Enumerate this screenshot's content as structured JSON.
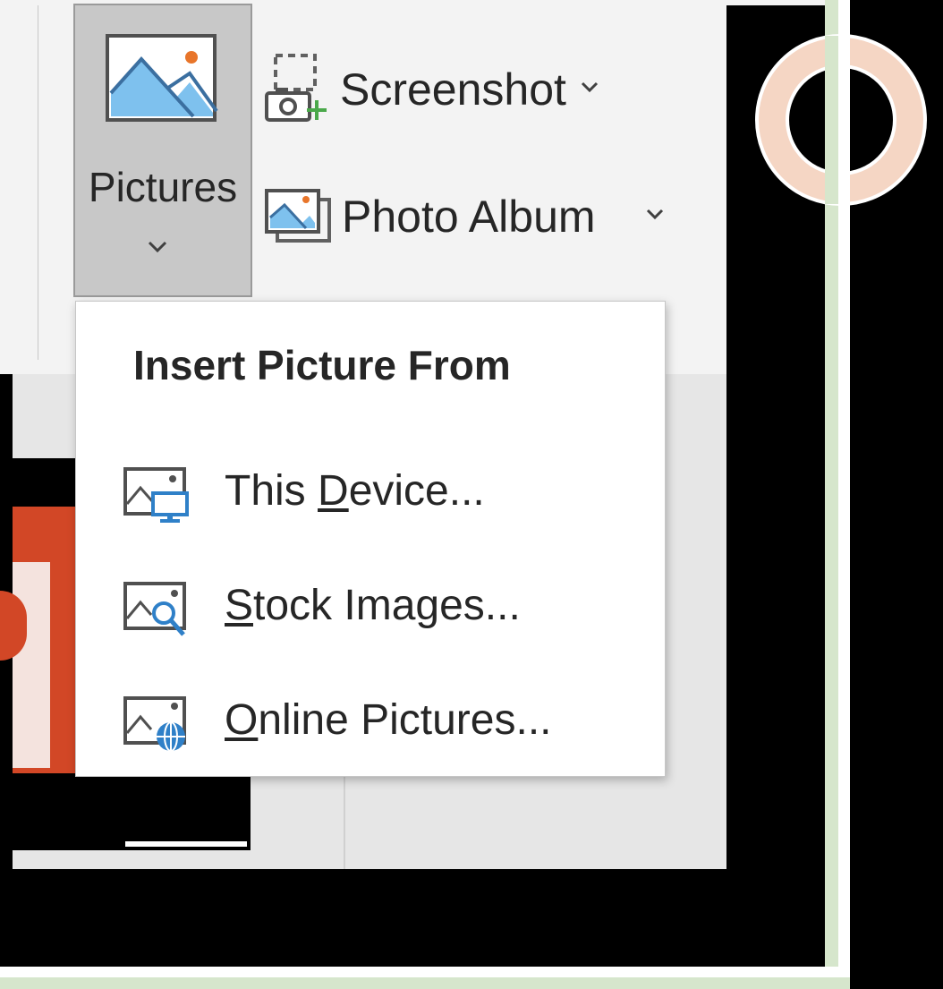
{
  "ribbon": {
    "pictures_label": "Pictures",
    "screenshot_label": "Screenshot",
    "photo_album_label": "Photo Album"
  },
  "dropdown": {
    "header": "Insert Picture From",
    "items": [
      {
        "label": "This Device...",
        "mnemonic": "D",
        "before": "This ",
        "key": "D",
        "after": "evice..."
      },
      {
        "label": "Stock Images...",
        "mnemonic": "S",
        "before": "",
        "key": "S",
        "after": "tock Images..."
      },
      {
        "label": "Online Pictures...",
        "mnemonic": "O",
        "before": "",
        "key": "O",
        "after": "nline Pictures..."
      }
    ]
  },
  "icons": {
    "pictures": "pictures-icon",
    "screenshot": "screenshot-icon",
    "photo_album": "photo-album-icon",
    "this_device": "picture-device-icon",
    "stock_images": "picture-search-icon",
    "online_pictures": "picture-globe-icon",
    "chevron": "chevron-down-icon"
  },
  "colors": {
    "pressed_button": "#c8c8c8",
    "picture_icon_blue": "#3b8fd6",
    "picture_icon_sun": "#e8752a",
    "powerpoint_red": "#d24726",
    "frame_green": "#d6e6cc",
    "circle_peach": "#f5d6c4"
  }
}
